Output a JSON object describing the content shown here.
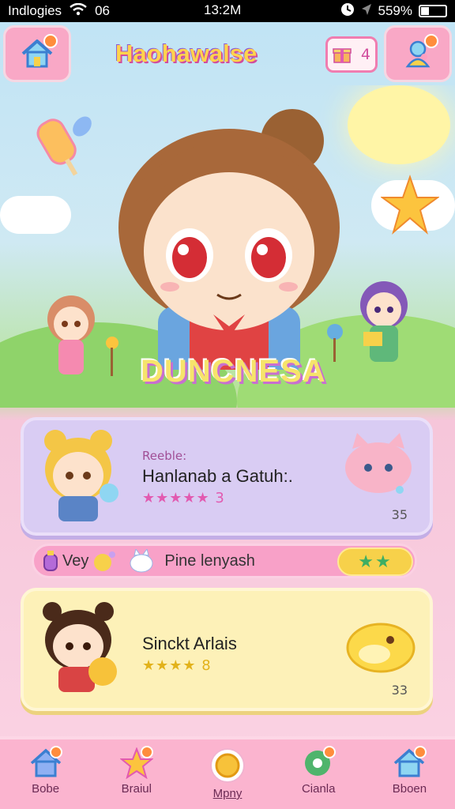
{
  "status": {
    "carrier": "Indlogies",
    "signal_extra": "06",
    "time": "13:2M",
    "battery": "559%"
  },
  "header": {
    "title": "Haohawalse",
    "badge_count": "4"
  },
  "hero": {
    "name": "DUNCNESA"
  },
  "card1": {
    "label": "Reeble:",
    "title": "Hanlanab a Gatuh:.",
    "stars": "★★★★★ 3",
    "number": "35"
  },
  "strip": {
    "item1": "Vey",
    "item2": "Pine lenyash",
    "button_stars": "★★"
  },
  "card2": {
    "title": "Sinckt Arlais",
    "stars": "★★★★ 8",
    "number": "33"
  },
  "nav": [
    {
      "label": "Bobe"
    },
    {
      "label": "Braiul"
    },
    {
      "label": "Mpny"
    },
    {
      "label": "Cianla"
    },
    {
      "label": "Bboen"
    }
  ],
  "colors": {
    "accent": "#f9a8c6",
    "card1": "#d9ccf3",
    "card2": "#fdf1b8",
    "nav": "#fbb4cf"
  }
}
